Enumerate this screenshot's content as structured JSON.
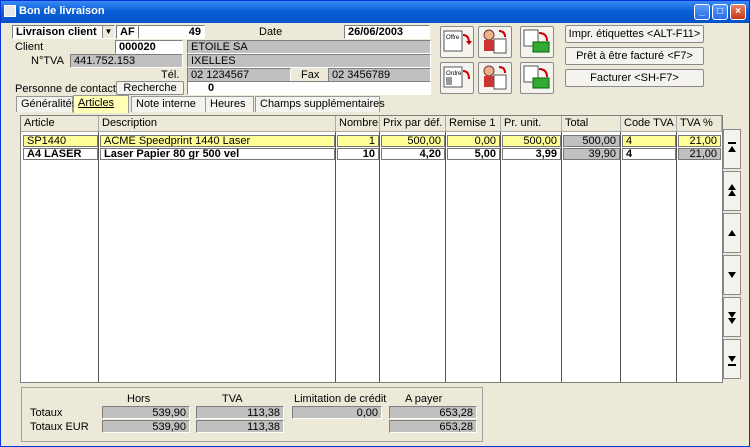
{
  "window": {
    "title": "Bon de livraison",
    "minimize": "_",
    "maximize": "□",
    "close": "×"
  },
  "header": {
    "doc_type": "Livraison client",
    "journal": "AF",
    "number": "49",
    "date_label": "Date",
    "date": "26/06/2003",
    "client_label": "Client",
    "client_code": "000020",
    "client_name": "ETOILE SA",
    "tva_label": "N°TVA",
    "tva_value": "441.752.153",
    "city": "IXELLES",
    "tel_label": "Tél.",
    "tel": "02 1234567",
    "fax_label": "Fax",
    "fax": "02 3456789",
    "contact_label": "Personne de contact",
    "search_label": "Recherche",
    "contact_value": "0"
  },
  "actions": {
    "print_labels": "Impr. étiquettes <ALT-F11>",
    "ready_invoice": "Prêt à être facturé <F7>",
    "invoice": "Facturer <SH-F7>",
    "icon_labels": [
      "Offre",
      "Offre",
      "Ordre",
      "Ordre"
    ]
  },
  "tabs": [
    "Généralités",
    "Articles",
    "Note interne",
    "Heures",
    "Champs supplémentaires"
  ],
  "table": {
    "columns": [
      "Article",
      "Description",
      "Nombre",
      "Prix par déf.",
      "Remise 1",
      "Pr. unit.",
      "Total",
      "Code TVA",
      "TVA %"
    ],
    "rows": [
      [
        "SP1440",
        "ACME Speedprint 1440 Laser",
        "1",
        "500,00",
        "0,00",
        "500,00",
        "500,00",
        "4",
        "21,00"
      ],
      [
        "A4 LASER",
        "Laser Papier 80 gr 500 vel",
        "10",
        "4,20",
        "5,00",
        "3,99",
        "39,90",
        "4",
        "21,00"
      ]
    ]
  },
  "totals": {
    "headers": [
      "Hors",
      "TVA",
      "Limitation de crédit",
      "A payer"
    ],
    "row1_label": "Totaux",
    "row1": [
      "539,90",
      "113,38",
      "0,00",
      "653,28"
    ],
    "row2_label": "Totaux EUR",
    "row2": [
      "539,90",
      "113,38",
      "",
      "653,28"
    ]
  }
}
